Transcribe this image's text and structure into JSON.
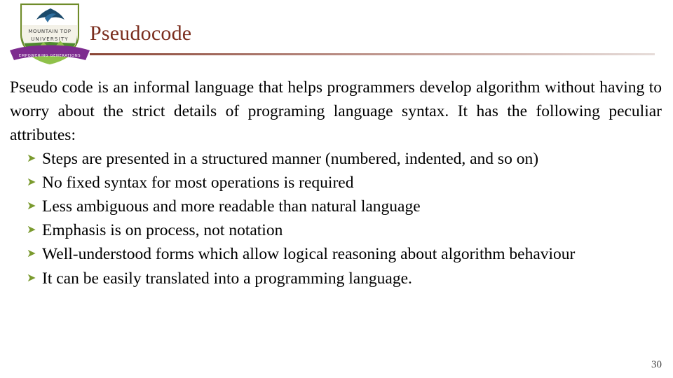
{
  "slide": {
    "title": "Pseudocode",
    "page_number": "30",
    "title_color": "#7B2E1E",
    "bullet_color": "#7a9a2e",
    "paragraph": "Pseudo code is an informal language that helps programmers develop algorithm without having to worry about the strict details of programing language syntax. It has the following peculiar attributes:",
    "bullets": [
      "Steps are presented in a structured manner (numbered, indented, and so on)",
      "No fixed syntax for most operations is required",
      "Less ambiguous and more readable than natural language",
      "Emphasis is on process, not notation",
      "Well-understood forms which allow logical reasoning about algorithm behaviour",
      "It can be easily translated into a programming language."
    ]
  },
  "logo": {
    "name": "mountain-top-university-logo",
    "line1": "MOUNTAIN TOP",
    "line2": "UNIVERSITY",
    "ribbon": "EMPOWERING GENERATIONS"
  }
}
